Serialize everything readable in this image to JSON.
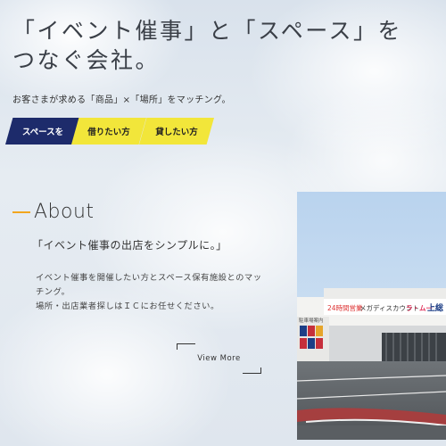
{
  "hero": {
    "title_line1": "「イベント催事」と「スペース」を",
    "title_line2": "つなぐ会社。",
    "subtitle": "お客さまが求める「商品」×「場所」をマッチング。"
  },
  "tabs": [
    {
      "label": "スペースを",
      "active": true
    },
    {
      "label": "借りたい方",
      "active": false
    },
    {
      "label": "貸したい方",
      "active": false
    }
  ],
  "about": {
    "title": "About",
    "catch": "「イベント催事の出店をシンプルに。」",
    "body_line1": "イベント催事を開催したい方とスペース保有施設とのマッ",
    "body_line2": "チング。",
    "body_line3": "場所・出店業者探しはＩＣにお任せください。",
    "view_more": "View More"
  },
  "photo": {
    "sign_text": "メガディスカウント",
    "sign_text2": "ラ・ムー",
    "sign_text3": "上総",
    "sign_small": "24時間営業",
    "side_text": "駐車場案内"
  },
  "colors": {
    "navy": "#1d2b6b",
    "yellow": "#f2e63a",
    "accent_orange": "#f2a61e"
  }
}
